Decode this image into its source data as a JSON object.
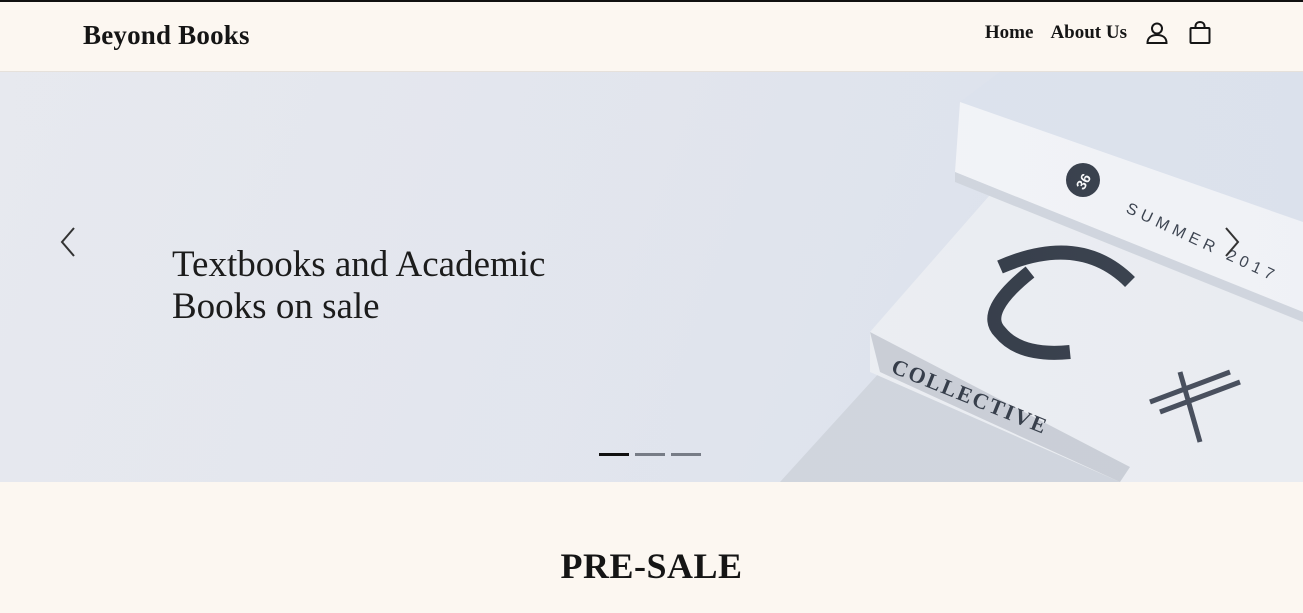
{
  "header": {
    "logo": "Beyond Books",
    "nav": [
      {
        "label": "Home"
      },
      {
        "label": "About Us"
      }
    ],
    "icons": [
      "user-icon",
      "shopping-bag-icon"
    ]
  },
  "hero": {
    "title_line1": "Textbooks and Academic",
    "title_line2": "Books on sale",
    "slides_count": 3,
    "active_slide": 1,
    "image_text": {
      "badge": "36",
      "issue": "SUMMER 2017",
      "brand": "COLLECTIVE"
    }
  },
  "section": {
    "title": "PRE-SALE"
  },
  "colors": {
    "page_background": "#fcf7f1",
    "text": "#151515",
    "hero_background": "#e3e6ee"
  }
}
